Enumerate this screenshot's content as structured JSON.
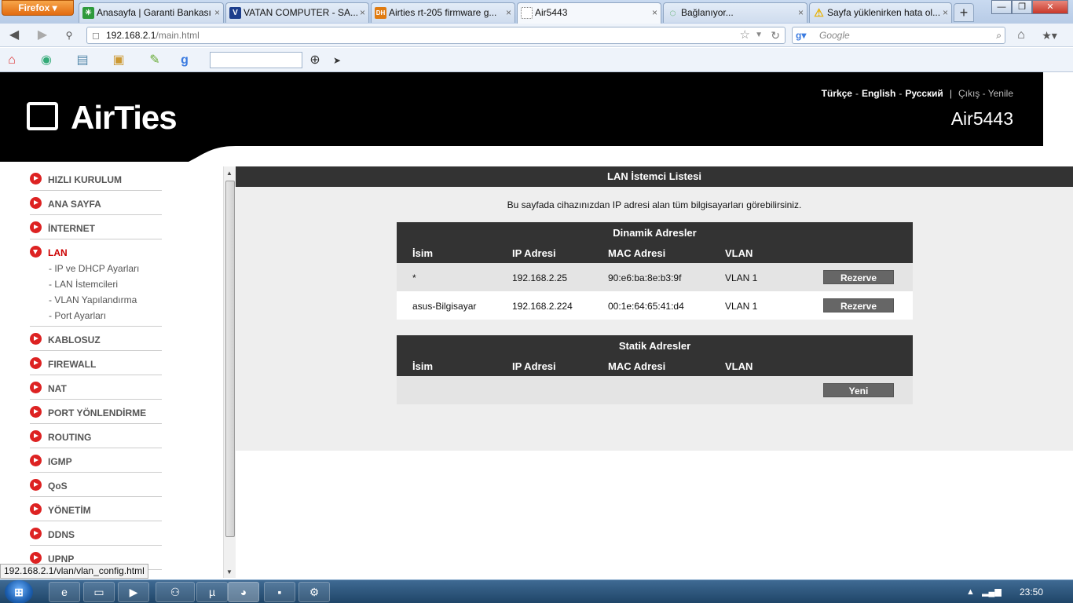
{
  "browser": {
    "menu_button": "Firefox ▾",
    "tabs": [
      {
        "title": "Anasayfa | Garanti Bankası",
        "icon": "✳",
        "icon_color": "#2e9a3c"
      },
      {
        "title": "VATAN COMPUTER - SA...",
        "icon": "V",
        "icon_color": "#1d3e8c"
      },
      {
        "title": "Airties rt-205 firmware g...",
        "icon": "DH",
        "icon_color": "#e07b10"
      },
      {
        "title": "Air5443",
        "icon": "",
        "icon_color": "#ffffff"
      },
      {
        "title": "Bağlanıyor...",
        "icon": "◌",
        "icon_color": "#2e9a3c"
      },
      {
        "title": "Sayfa yüklenirken hata ol...",
        "icon": "⚠",
        "icon_color": "#e8b000"
      }
    ],
    "close_glyph": "×",
    "new_tab": "+",
    "window_controls": {
      "minimize": "—",
      "maximize": "❐",
      "close": "✕"
    },
    "url_host": "192.168.2.1",
    "url_path": "/main.html",
    "search_placeholder": "Google",
    "status_url": "192.168.2.1/vlan/vlan_config.html"
  },
  "router": {
    "brand": "AirTies",
    "model": "Air5443",
    "languages": [
      "Türkçe",
      "English",
      "Русский"
    ],
    "logout": "Çıkış",
    "refresh": "Yenile",
    "menu": [
      {
        "label": "HIZLI KURULUM"
      },
      {
        "label": "ANA SAYFA"
      },
      {
        "label": "İNTERNET"
      },
      {
        "label": "LAN",
        "active": true
      },
      {
        "label": "KABLOSUZ"
      },
      {
        "label": "FIREWALL"
      },
      {
        "label": "NAT"
      },
      {
        "label": "PORT YÖNLENDİRME"
      },
      {
        "label": "ROUTING"
      },
      {
        "label": "IGMP"
      },
      {
        "label": "QoS"
      },
      {
        "label": "YÖNETİM"
      },
      {
        "label": "DDNS"
      },
      {
        "label": "UPNP"
      }
    ],
    "lan_submenu": [
      "- IP ve DHCP Ayarları",
      "- LAN İstemcileri",
      "- VLAN Yapılandırma",
      "- Port Ayarları"
    ],
    "content": {
      "title": "LAN İstemci Listesi",
      "description": "Bu sayfada cihazınızdan IP adresi alan tüm bilgisayarları görebilirsiniz.",
      "columns": [
        "İsim",
        "IP Adresi",
        "MAC Adresi",
        "VLAN"
      ],
      "dynamic": {
        "title": "Dinamik Adresler",
        "rows": [
          {
            "name": "*",
            "ip": "192.168.2.25",
            "mac": "90:e6:ba:8e:b3:9f",
            "vlan": "VLAN 1",
            "action": "Rezerve"
          },
          {
            "name": "asus-Bilgisayar",
            "ip": "192.168.2.224",
            "mac": "00:1e:64:65:41:d4",
            "vlan": "VLAN 1",
            "action": "Rezerve"
          }
        ]
      },
      "static": {
        "title": "Statik Adresler",
        "new_button": "Yeni"
      }
    }
  },
  "taskbar": {
    "time": "23:50"
  }
}
